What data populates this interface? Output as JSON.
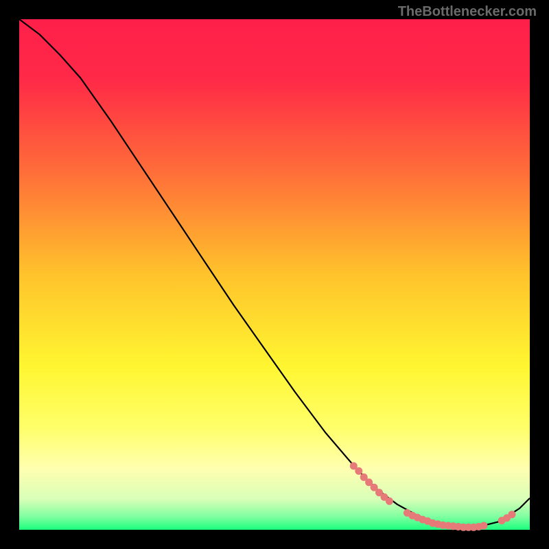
{
  "attribution": "TheBottlenecker.com",
  "colors": {
    "bg": "#000000",
    "gradient_stops": [
      {
        "offset": 0.0,
        "color": "#ff1f4a"
      },
      {
        "offset": 0.12,
        "color": "#ff2a47"
      },
      {
        "offset": 0.3,
        "color": "#ff6e39"
      },
      {
        "offset": 0.5,
        "color": "#ffc32b"
      },
      {
        "offset": 0.68,
        "color": "#fff631"
      },
      {
        "offset": 0.8,
        "color": "#ffff6a"
      },
      {
        "offset": 0.88,
        "color": "#ffffb0"
      },
      {
        "offset": 0.94,
        "color": "#d9ffb8"
      },
      {
        "offset": 0.975,
        "color": "#7dff9f"
      },
      {
        "offset": 1.0,
        "color": "#1aff7d"
      }
    ],
    "curve": "#000000",
    "markers": "#e67a78"
  },
  "chart_data": {
    "type": "line",
    "title": "",
    "xlabel": "",
    "ylabel": "",
    "xlim": [
      0,
      100
    ],
    "ylim": [
      0,
      100
    ],
    "grid": false,
    "series": [
      {
        "name": "bottleneck-curve",
        "x": [
          0,
          4,
          8,
          12,
          18,
          24,
          30,
          36,
          42,
          48,
          54,
          60,
          66,
          70,
          74,
          78,
          82,
          86,
          90,
          94,
          98,
          100
        ],
        "y": [
          100,
          97,
          93,
          88.5,
          80,
          71,
          62,
          53,
          44,
          35.5,
          27,
          19,
          12,
          8,
          5,
          2.8,
          1.4,
          0.6,
          0.6,
          1.6,
          4.2,
          6.2
        ]
      }
    ],
    "markers": [
      {
        "x": 65.5,
        "y": 12.5
      },
      {
        "x": 66.5,
        "y": 11.5
      },
      {
        "x": 67.5,
        "y": 10.3
      },
      {
        "x": 68.5,
        "y": 9.3
      },
      {
        "x": 69.5,
        "y": 8.3
      },
      {
        "x": 70.5,
        "y": 7.3
      },
      {
        "x": 71.5,
        "y": 6.4
      },
      {
        "x": 72.5,
        "y": 5.6
      },
      {
        "x": 76.0,
        "y": 3.3
      },
      {
        "x": 77.0,
        "y": 2.8
      },
      {
        "x": 78.0,
        "y": 2.4
      },
      {
        "x": 79.0,
        "y": 2.0
      },
      {
        "x": 80.0,
        "y": 1.7
      },
      {
        "x": 81.0,
        "y": 1.3
      },
      {
        "x": 82.0,
        "y": 1.1
      },
      {
        "x": 83.0,
        "y": 0.9
      },
      {
        "x": 84.0,
        "y": 0.8
      },
      {
        "x": 85.0,
        "y": 0.7
      },
      {
        "x": 86.0,
        "y": 0.6
      },
      {
        "x": 87.0,
        "y": 0.5
      },
      {
        "x": 88.0,
        "y": 0.5
      },
      {
        "x": 89.0,
        "y": 0.5
      },
      {
        "x": 90.0,
        "y": 0.6
      },
      {
        "x": 91.0,
        "y": 0.8
      },
      {
        "x": 94.5,
        "y": 1.8
      },
      {
        "x": 95.5,
        "y": 2.3
      },
      {
        "x": 96.5,
        "y": 3.0
      }
    ]
  }
}
